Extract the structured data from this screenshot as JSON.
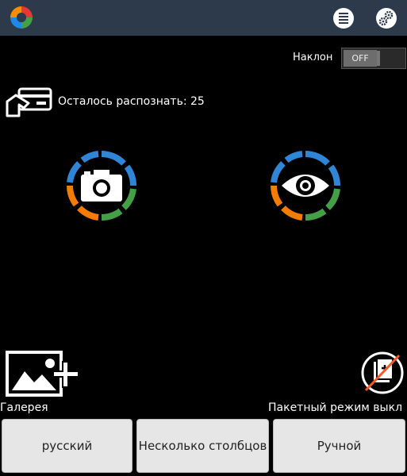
{
  "header": {
    "logo_icon": "app-logo-aperture-icon",
    "menu_icon": "list-icon",
    "settings_icon": "gears-icon",
    "bg_color": "#2d3a4c"
  },
  "tilt": {
    "label": "Наклон",
    "toggle_state": "OFF"
  },
  "recognition": {
    "label": "Осталось распознать: 25",
    "card_icon": "card-hand-icon"
  },
  "actions": {
    "camera_icon": "camera-icon",
    "eye_icon": "eye-icon"
  },
  "gallery": {
    "label": "Галерея",
    "icon": "gallery-add-icon"
  },
  "batch": {
    "label": "Пакетный режим выкл",
    "icon": "batch-mode-off-icon"
  },
  "bottom_buttons": {
    "language": "русский",
    "columns": "Несколько столбцов",
    "mode": "Ручной"
  }
}
